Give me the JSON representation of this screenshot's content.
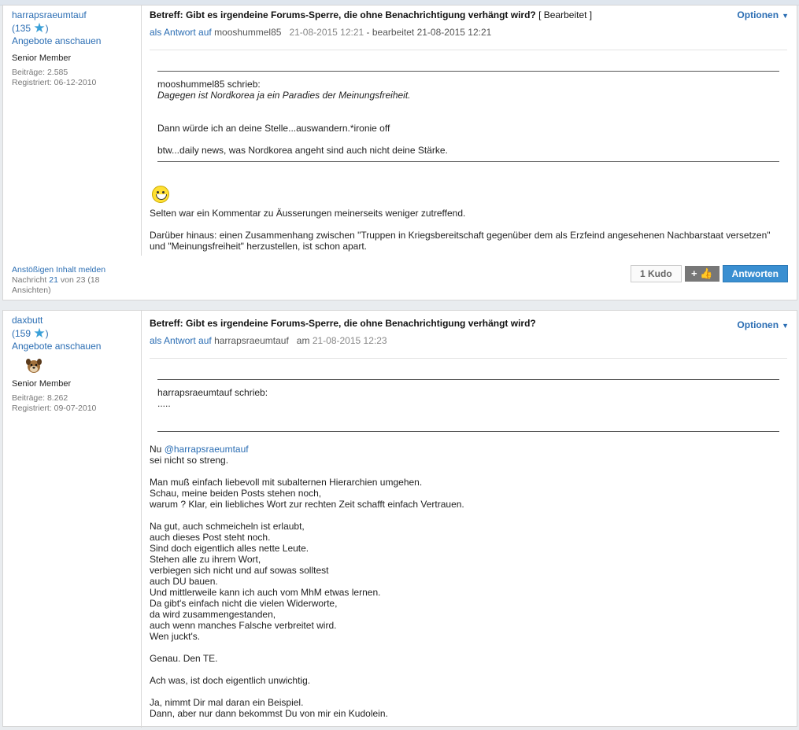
{
  "posts": [
    {
      "author": {
        "name": "harrapsraeumtauf",
        "kudos": "135",
        "offers": "Angebote anschauen",
        "rank": "Senior Member",
        "posts": "Beiträge: 2.585",
        "registered": "Registriert: 06-12-2010"
      },
      "subject": "Betreff: Gibt es irgendeine Forums-Sperre, die ohne Benachrichtigung verhängt wird?",
      "edited_tag": "[ Bearbeitet ]",
      "options": "Optionen",
      "reply_prefix": "als Antwort auf",
      "reply_to": "mooshummel85",
      "date": "21-08-2015 12:21",
      "edited": "- bearbeitet 21-08-2015 12:21",
      "quote": {
        "header": "mooshummel85 schrieb:",
        "text": "Dagegen ist Nordkorea ja ein Paradies der Meinungsfreiheit.",
        "p1": "Dann würde ich an deine Stelle...auswandern.*ironie off",
        "p2": "btw...daily news, was Nordkorea angeht sind auch nicht deine Stärke."
      },
      "smiley": "grinning-smiley",
      "body": [
        "Selten war ein Kommentar zu Äusserungen meinerseits weniger zutreffend.",
        "Darüber hinaus: einen Zusammenhang zwischen \"Truppen in Kriegsbereitschaft gegenüber dem als Erzfeind angesehenen Nachbarstaat versetzen\" und \"Meinungsfreiheit\" herzustellen, ist schon apart."
      ],
      "report": "Anstößigen Inhalt melden",
      "msg_prefix": "Nachricht",
      "msg_num": "21",
      "msg_suffix": "von 23 (18 Ansichten)",
      "kudo_btn": "1 Kudo",
      "kudo_plus": "+",
      "reply_btn": "Antworten"
    },
    {
      "author": {
        "name": "daxbutt",
        "kudos": "159",
        "offers": "Angebote anschauen",
        "rank": "Senior Member",
        "posts": "Beiträge: 8.262",
        "registered": "Registriert: 09-07-2010"
      },
      "subject": "Betreff: Gibt es irgendeine Forums-Sperre, die ohne Benachrichtigung verhängt wird?",
      "options": "Optionen",
      "reply_prefix": "als Antwort auf",
      "reply_to": "harrapsraeumtauf",
      "date_prefix": "am",
      "date": "21-08-2015 12:23",
      "quote": {
        "header": "harrapsraeumtauf schrieb:",
        "text": "....."
      },
      "mention_prefix": "Nu",
      "mention": "@harrapsraeumtauf",
      "body": [
        [
          "sei nicht so streng."
        ],
        [
          "Man muß einfach liebevoll mit subalternen Hierarchien umgehen.",
          "Schau, meine beiden Posts stehen noch,",
          "warum ? Klar, ein liebliches Wort zur rechten Zeit schafft einfach Vertrauen."
        ],
        [
          "Na gut, auch schmeicheln ist erlaubt,",
          "auch dieses Post steht noch.",
          "Sind doch eigentlich alles nette Leute.",
          "Stehen alle zu ihrem Wort,",
          "verbiegen sich nicht und  auf sowas solltest",
          "auch DU bauen.",
          "Und mittlerweile kann ich auch vom MhM etwas lernen.",
          "Da gibt's einfach nicht die vielen Widerworte,",
          "da wird zusammengestanden,",
          "auch wenn manches Falsche verbreitet wird.",
          "Wen juckt's."
        ],
        [
          "Genau. Den TE."
        ],
        [
          "Ach was, ist doch eigentlich unwichtig."
        ],
        [
          "Ja, nimmt Dir mal daran ein Beispiel.",
          "Dann, aber nur dann bekommst Du von mir ein Kudolein."
        ]
      ]
    }
  ]
}
